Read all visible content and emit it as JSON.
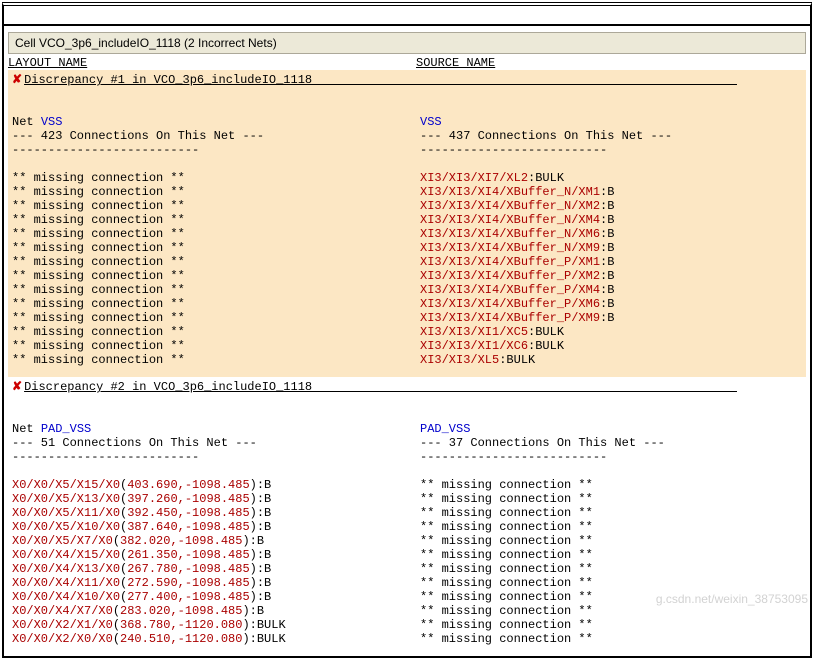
{
  "cell_header": "Cell VCO_3p6_includeIO_1118 (2 Incorrect Nets)",
  "columns": {
    "layout": "LAYOUT NAME",
    "source": "SOURCE NAME"
  },
  "discrepancies": [
    {
      "title": "Discrepancy #1 in VCO_3p6_includeIO_1118",
      "highlight": true,
      "layout": {
        "net_label": "Net ",
        "net_name": "VSS",
        "conn_line": "--- 423 Connections On This Net ---",
        "dashes": "--------------------------",
        "lines": [
          {
            "t": "** missing connection **",
            "red": false
          },
          {
            "t": "** missing connection **",
            "red": false
          },
          {
            "t": "** missing connection **",
            "red": false
          },
          {
            "t": "** missing connection **",
            "red": false
          },
          {
            "t": "** missing connection **",
            "red": false
          },
          {
            "t": "** missing connection **",
            "red": false
          },
          {
            "t": "** missing connection **",
            "red": false
          },
          {
            "t": "** missing connection **",
            "red": false
          },
          {
            "t": "** missing connection **",
            "red": false
          },
          {
            "t": "** missing connection **",
            "red": false
          },
          {
            "t": "** missing connection **",
            "red": false
          },
          {
            "t": "** missing connection **",
            "red": false
          },
          {
            "t": "** missing connection **",
            "red": false
          },
          {
            "t": "** missing connection **",
            "red": false
          }
        ]
      },
      "source": {
        "net_name": "VSS",
        "conn_line": "--- 437 Connections On This Net ---",
        "dashes": "--------------------------",
        "lines": [
          {
            "r": "XI3/XI3/XI7/XL2",
            "s": ":BULK"
          },
          {
            "r": "XI3/XI3/XI4/XBuffer_N/XM1",
            "s": ":B"
          },
          {
            "r": "XI3/XI3/XI4/XBuffer_N/XM2",
            "s": ":B"
          },
          {
            "r": "XI3/XI3/XI4/XBuffer_N/XM4",
            "s": ":B"
          },
          {
            "r": "XI3/XI3/XI4/XBuffer_N/XM6",
            "s": ":B"
          },
          {
            "r": "XI3/XI3/XI4/XBuffer_N/XM9",
            "s": ":B"
          },
          {
            "r": "XI3/XI3/XI4/XBuffer_P/XM1",
            "s": ":B"
          },
          {
            "r": "XI3/XI3/XI4/XBuffer_P/XM2",
            "s": ":B"
          },
          {
            "r": "XI3/XI3/XI4/XBuffer_P/XM4",
            "s": ":B"
          },
          {
            "r": "XI3/XI3/XI4/XBuffer_P/XM6",
            "s": ":B"
          },
          {
            "r": "XI3/XI3/XI4/XBuffer_P/XM9",
            "s": ":B"
          },
          {
            "r": "XI3/XI3/XI1/XC5",
            "s": ":BULK"
          },
          {
            "r": "XI3/XI3/XI1/XC6",
            "s": ":BULK"
          },
          {
            "r": "XI3/XI3/XL5",
            "s": ":BULK"
          }
        ]
      }
    },
    {
      "title": "Discrepancy #2 in VCO_3p6_includeIO_1118",
      "highlight": false,
      "layout": {
        "net_label": "Net ",
        "net_name": "PAD_VSS",
        "conn_line": "--- 51 Connections On This Net ---",
        "dashes": "--------------------------",
        "lines": [
          {
            "p": "X0/X0/X5/X15/X0",
            "c": "(403.690,-1098.485)",
            "s": ":B"
          },
          {
            "p": "X0/X0/X5/X13/X0",
            "c": "(397.260,-1098.485)",
            "s": ":B"
          },
          {
            "p": "X0/X0/X5/X11/X0",
            "c": "(392.450,-1098.485)",
            "s": ":B"
          },
          {
            "p": "X0/X0/X5/X10/X0",
            "c": "(387.640,-1098.485)",
            "s": ":B"
          },
          {
            "p": "X0/X0/X5/X7/X0",
            "c": "(382.020,-1098.485)",
            "s": ":B"
          },
          {
            "p": "X0/X0/X4/X15/X0",
            "c": "(261.350,-1098.485)",
            "s": ":B"
          },
          {
            "p": "X0/X0/X4/X13/X0",
            "c": "(267.780,-1098.485)",
            "s": ":B"
          },
          {
            "p": "X0/X0/X4/X11/X0",
            "c": "(272.590,-1098.485)",
            "s": ":B"
          },
          {
            "p": "X0/X0/X4/X10/X0",
            "c": "(277.400,-1098.485)",
            "s": ":B"
          },
          {
            "p": "X0/X0/X4/X7/X0",
            "c": "(283.020,-1098.485)",
            "s": ":B"
          },
          {
            "p": "X0/X0/X2/X1/X0",
            "c": "(368.780,-1120.080)",
            "s": ":BULK"
          },
          {
            "p": "X0/X0/X2/X0/X0",
            "c": "(240.510,-1120.080)",
            "s": ":BULK"
          }
        ]
      },
      "source": {
        "net_name": "PAD_VSS",
        "conn_line": "--- 37 Connections On This Net ---",
        "dashes": "--------------------------",
        "lines": [
          {
            "t": "** missing connection **"
          },
          {
            "t": "** missing connection **"
          },
          {
            "t": "** missing connection **"
          },
          {
            "t": "** missing connection **"
          },
          {
            "t": "** missing connection **"
          },
          {
            "t": "** missing connection **"
          },
          {
            "t": "** missing connection **"
          },
          {
            "t": "** missing connection **"
          },
          {
            "t": "** missing connection **"
          },
          {
            "t": "** missing connection **"
          },
          {
            "t": "** missing connection **"
          },
          {
            "t": "** missing connection **"
          }
        ]
      }
    }
  ],
  "watermark": "g.csdn.net/weixin_38753095"
}
